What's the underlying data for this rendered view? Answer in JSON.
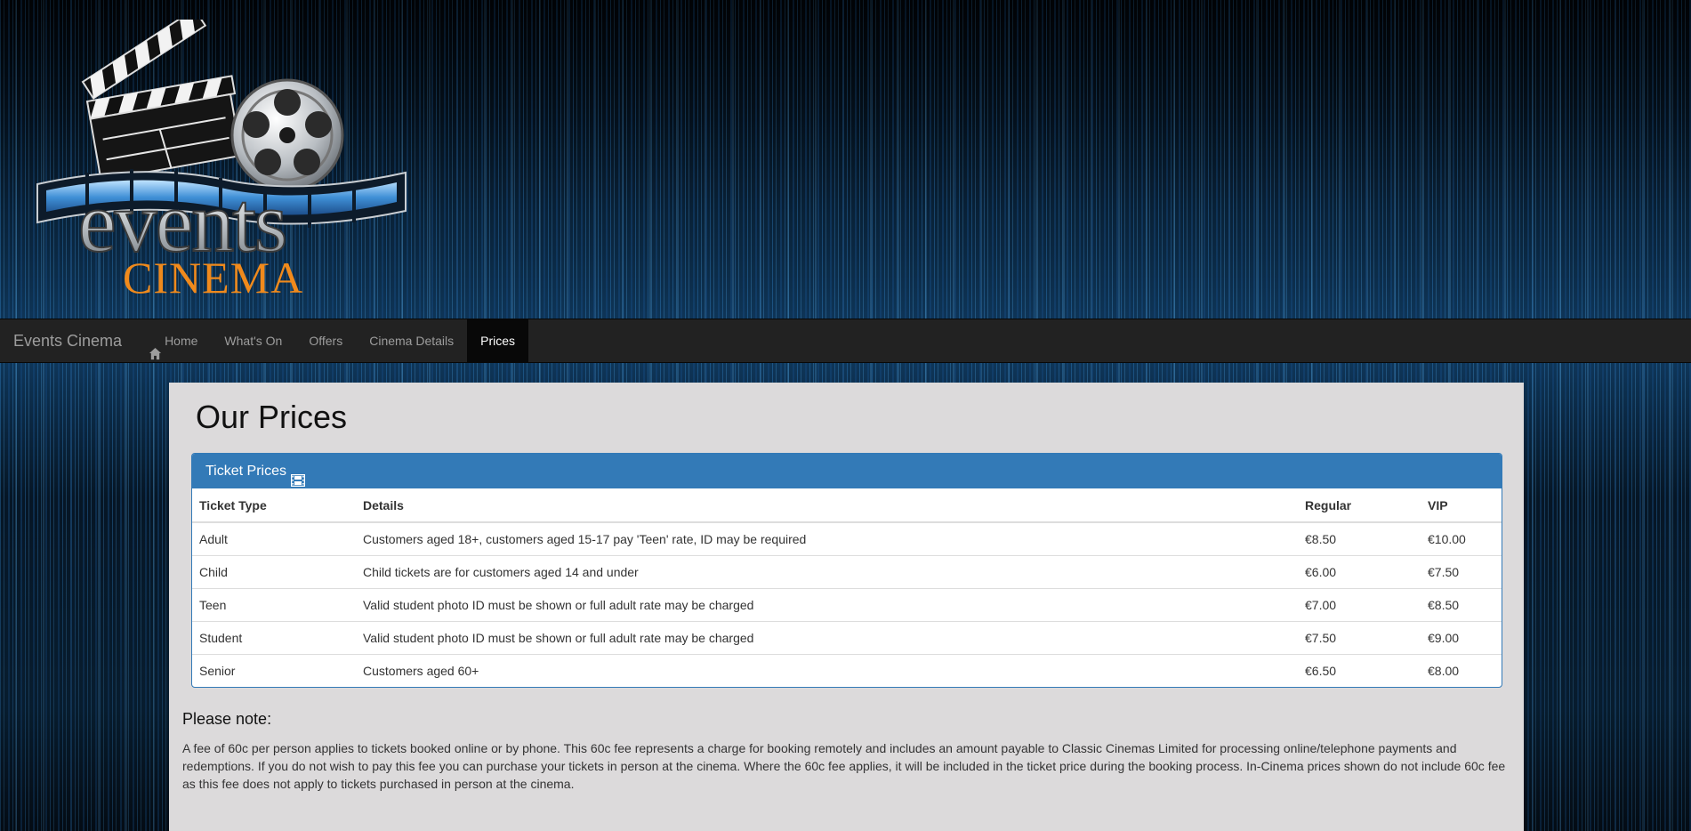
{
  "logo": {
    "word_events": "events",
    "word_cinema": "CINEMA"
  },
  "navbar": {
    "brand": "Events Cinema",
    "items": [
      {
        "label": "Home",
        "icon": "home-icon",
        "active": false
      },
      {
        "label": "What's On",
        "active": false
      },
      {
        "label": "Offers",
        "active": false
      },
      {
        "label": "Cinema Details",
        "active": false
      },
      {
        "label": "Prices",
        "active": true
      }
    ]
  },
  "main": {
    "title": "Our Prices",
    "panel": {
      "heading": "Ticket Prices",
      "heading_icon": "film-icon",
      "columns": [
        "Ticket Type",
        "Details",
        "Regular",
        "VIP"
      ],
      "rows": [
        [
          "Adult",
          "Customers aged 18+, customers aged 15-17 pay 'Teen' rate, ID may be required",
          "€8.50",
          "€10.00"
        ],
        [
          "Child",
          "Child tickets are for customers aged 14 and under",
          "€6.00",
          "€7.50"
        ],
        [
          "Teen",
          "Valid student photo ID must be shown or full adult rate may be charged",
          "€7.00",
          "€8.50"
        ],
        [
          "Student",
          "Valid student photo ID must be shown or full adult rate may be charged",
          "€7.50",
          "€9.00"
        ],
        [
          "Senior",
          "Customers aged 60+",
          "€6.50",
          "€8.00"
        ]
      ]
    },
    "note": {
      "title": "Please note:",
      "text": "A fee of 60c per person applies to tickets booked online or by phone. This 60c fee represents a charge for booking remotely and includes an amount payable to Classic Cinemas Limited for processing online/telephone payments and redemptions. If you do not wish to pay this fee you can purchase your tickets in person at the cinema. Where the 60c fee applies, it will be included in the ticket price during the booking process. In-Cinema prices shown do not include 60c fee as this fee does not apply to tickets purchased in person at the cinema."
    }
  },
  "colors": {
    "navbar_bg": "#222222",
    "panel_primary": "#337ab7",
    "content_bg": "#dcdadb",
    "logo_orange": "#f08a1c"
  }
}
